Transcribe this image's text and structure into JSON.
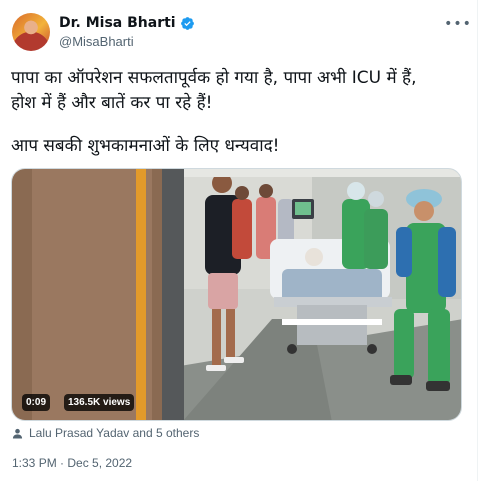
{
  "author": {
    "name": "Dr. Misa Bharti",
    "handle": "@MisaBharti",
    "verified": true
  },
  "more_icon": "more-horizontal-icon",
  "tweet": {
    "line1": "पापा का ऑपरेशन सफलतापूर्वक हो गया है, पापा अभी ICU में हैं,",
    "line2": "होश में हैं और बातें कर पा रहे हैं!",
    "line3": "आप सबकी शुभकामनाओं के लिए धन्यवाद!"
  },
  "media": {
    "duration": "0:09",
    "views": "136.5K views"
  },
  "tagged": "Lalu Prasad Yadav and 5 others",
  "timestamp": "1:33 PM · Dec 5, 2022",
  "colors": {
    "verified": "#1d9bf0",
    "secondary_text": "#536471",
    "scrubs": "#3aa35b",
    "door_stripe": "#e39a2a"
  }
}
